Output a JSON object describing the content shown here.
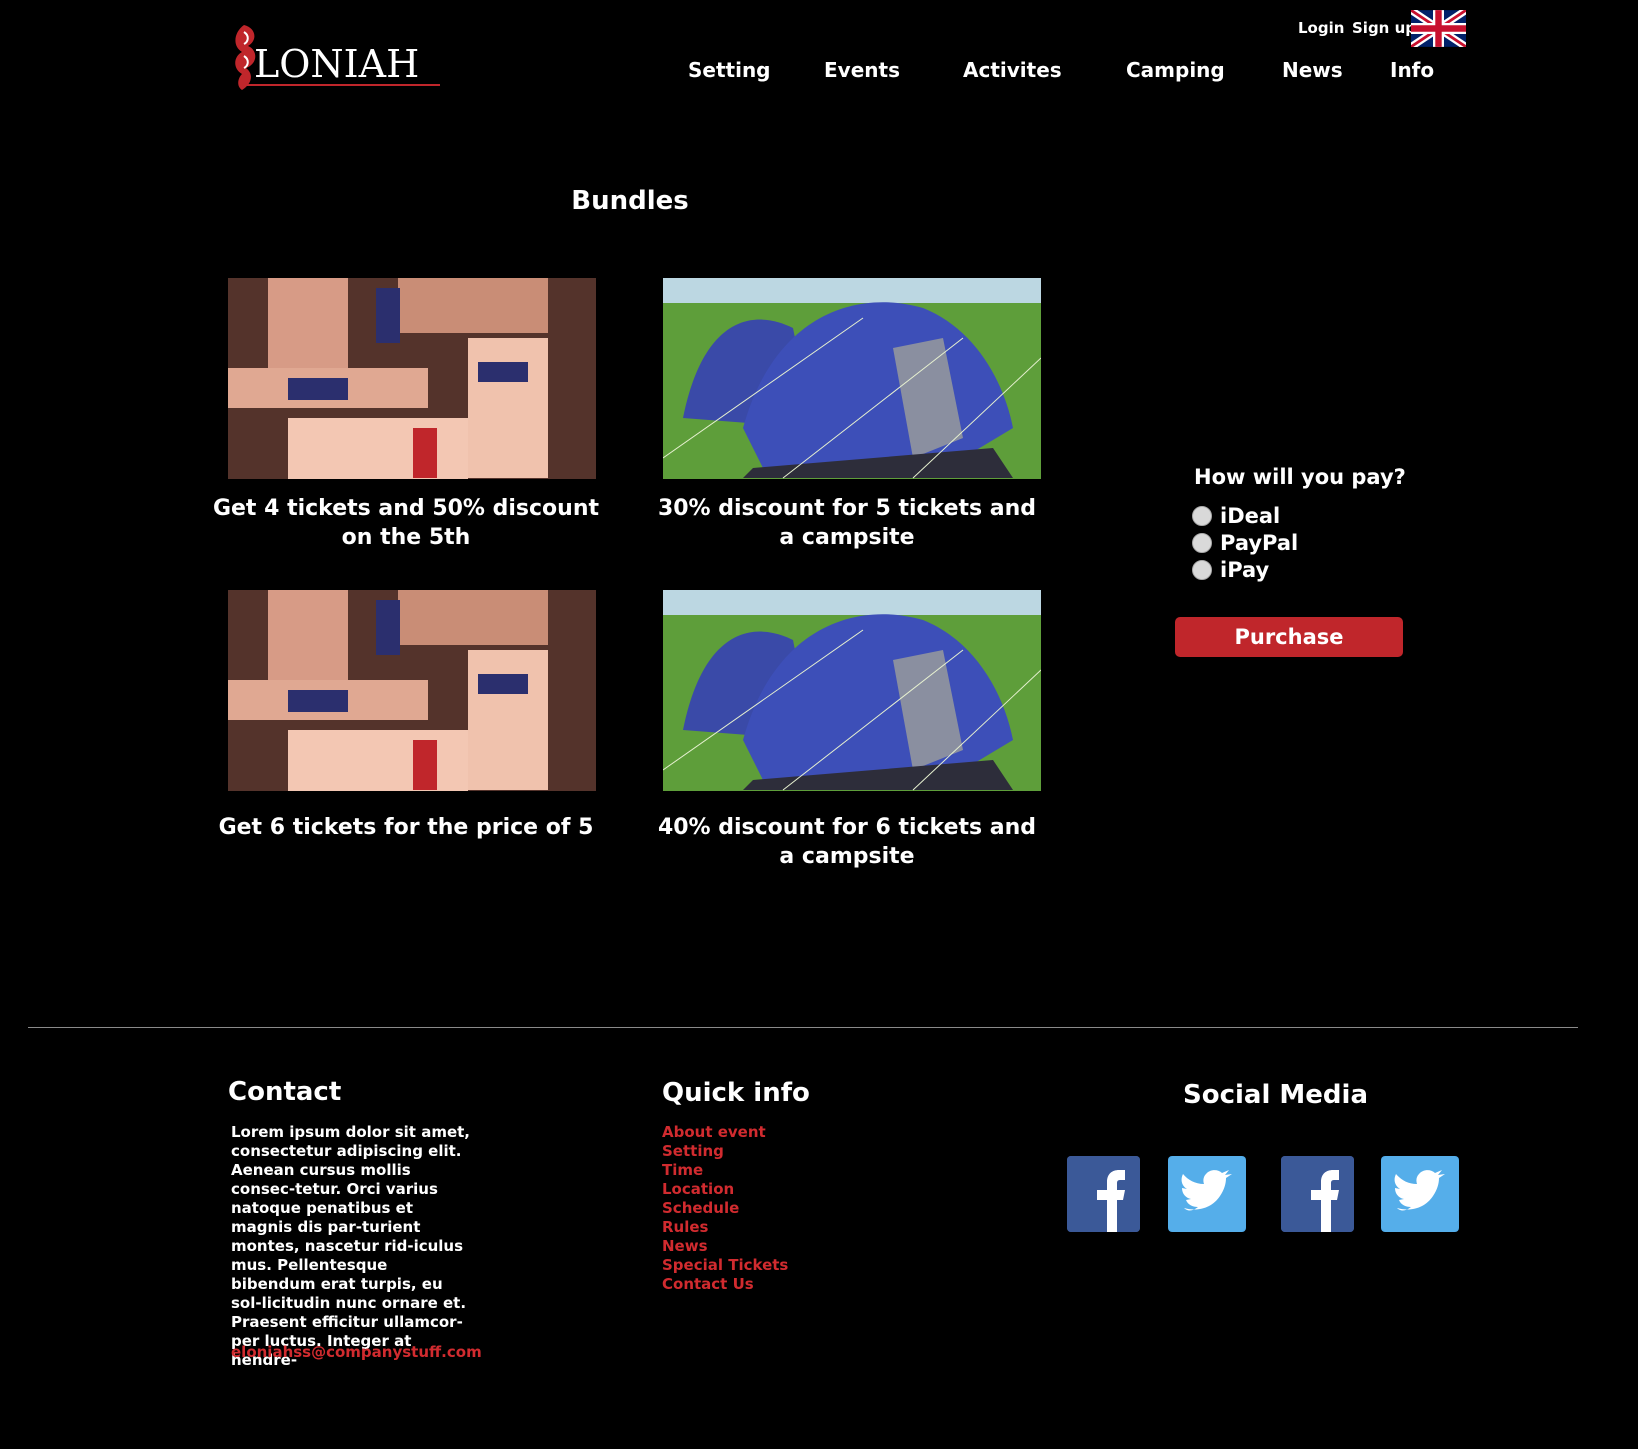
{
  "header": {
    "logo_text": "LONIAH",
    "login_label": "Login",
    "signup_label": "Sign up",
    "nav": [
      "Setting",
      "Events",
      "Activites",
      "Camping",
      "News",
      "Info"
    ]
  },
  "main": {
    "title": "Bundles",
    "bundles": [
      {
        "caption_line1": "Get 4 tickets and 50% discount",
        "caption_line2": "on the 5th"
      },
      {
        "caption_line1": "30% discount for 5 tickets and",
        "caption_line2": "a campsite"
      },
      {
        "caption_line1": "Get 6 tickets for the price of 5",
        "caption_line2": ""
      },
      {
        "caption_line1": "40% discount for 6 tickets and",
        "caption_line2": "a campsite"
      }
    ]
  },
  "payment": {
    "title": "How will you pay?",
    "options": [
      "iDeal",
      "PayPal",
      "iPay"
    ],
    "purchase_label": "Purchase"
  },
  "footer": {
    "contact_title": "Contact",
    "contact_text": "Lorem ipsum dolor sit amet, consectetur adipiscing elit. Aenean cursus mollis consec-tetur. Orci varius natoque penatibus et magnis dis par-turient montes, nascetur rid-iculus mus. Pellentesque bibendum erat turpis, eu sol-licitudin nunc ornare et. Praesent efficitur ullamcor-per luctus. Integer at hendre-",
    "email": "eloniahss@companystuff.com",
    "quick_title": "Quick info",
    "quick_links": [
      "About event",
      "Setting",
      "Time",
      "Location",
      "Schedule",
      "Rules",
      "News",
      "Special Tickets",
      "Contact Us"
    ],
    "social_title": "Social Media",
    "social_icons": [
      "facebook-icon",
      "twitter-icon",
      "facebook-icon",
      "twitter-icon"
    ]
  },
  "colors": {
    "accent": "#c0262b",
    "background": "#000000",
    "link": "#d12b2f"
  }
}
